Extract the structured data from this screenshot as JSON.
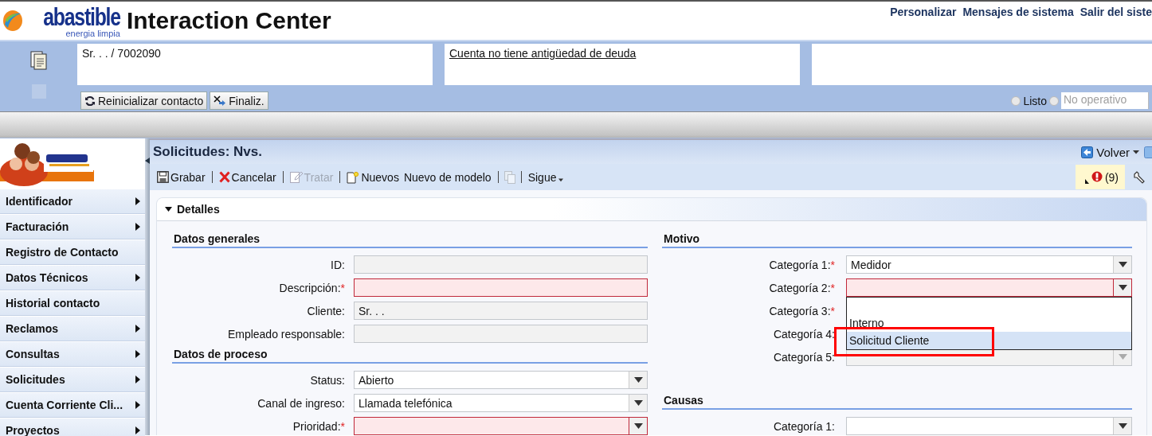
{
  "header": {
    "logo": {
      "name": "abastible",
      "tagline": "energia limpia"
    },
    "title": "Interaction Center",
    "links": [
      "Personalizar",
      "Mensajes de sistema",
      "Salir del siste"
    ]
  },
  "contact_bar": {
    "info_boxes": [
      {
        "kind": "plain",
        "text": "Sr. . . / 7002090"
      },
      {
        "kind": "link",
        "text": "Cuenta no tiene antigüedad de deuda "
      },
      {
        "kind": "empty"
      }
    ],
    "buttons": [
      "Reinicializar contacto",
      "Finaliz."
    ],
    "status_options": [
      {
        "label": "Listo",
        "selected": false,
        "kind": "radio"
      },
      {
        "label": "No operativo",
        "selected": false,
        "kind": "field"
      }
    ]
  },
  "sidebar": {
    "items": [
      {
        "label": "Identificador",
        "submenu": true
      },
      {
        "label": "Facturación",
        "submenu": true
      },
      {
        "label": "Registro de Contacto",
        "submenu": false
      },
      {
        "label": "Datos Técnicos",
        "submenu": true
      },
      {
        "label": "Historial contacto",
        "submenu": false
      },
      {
        "label": "Reclamos",
        "submenu": true
      },
      {
        "label": "Consultas",
        "submenu": true
      },
      {
        "label": "Solicitudes",
        "submenu": true
      },
      {
        "label": "Cuenta Corriente Cli...",
        "submenu": true
      },
      {
        "label": "Proyectos",
        "submenu": true
      }
    ]
  },
  "panel": {
    "title": "Solicitudes: Nvs.",
    "back": "Volver",
    "toolbar": [
      {
        "kind": "button",
        "label": "Grabar",
        "disabled": false
      },
      {
        "kind": "separator"
      },
      {
        "kind": "button",
        "label": "Cancelar",
        "disabled": false
      },
      {
        "kind": "separator"
      },
      {
        "kind": "button",
        "label": "Tratar",
        "disabled": true
      },
      {
        "kind": "separator"
      },
      {
        "kind": "button",
        "label": "Nuevos",
        "disabled": false
      },
      {
        "kind": "button",
        "label": "Nuevo de modelo",
        "disabled": false
      },
      {
        "kind": "separator"
      },
      {
        "kind": "icon",
        "disabled": true
      },
      {
        "kind": "separator"
      },
      {
        "kind": "menu",
        "label": "Sigue",
        "disabled": false
      }
    ],
    "messages": "(9)"
  },
  "details": {
    "title": "Detalles",
    "expanded": true,
    "columns": [
      {
        "sections": [
          {
            "title": "Datos generales",
            "fields": [
              {
                "label": "ID:",
                "kind": "text",
                "disabled": true,
                "error": false
              },
              {
                "label": "Descripción:",
                "required_mark": "*",
                "kind": "text",
                "disabled": false,
                "error": true
              },
              {
                "label": "Cliente:",
                "kind": "text",
                "value": "Sr. . .",
                "disabled": true,
                "error": false
              },
              {
                "label": "Empleado responsable:",
                "kind": "text",
                "disabled": true,
                "error": false
              }
            ]
          },
          {
            "title": "Datos de proceso",
            "fields": [
              {
                "label": "Status:",
                "kind": "select",
                "value": "Abierto",
                "disabled": false,
                "error": false
              },
              {
                "label": "Canal de ingreso:",
                "kind": "select",
                "value": "Llamada telefónica",
                "disabled": false,
                "error": false
              },
              {
                "label": "Prioridad:",
                "required_mark": "*",
                "kind": "select",
                "disabled": false,
                "error": true
              }
            ]
          }
        ]
      },
      {
        "sections": [
          {
            "title": "Motivo",
            "fields": [
              {
                "label": "Categoría 1:",
                "required_mark": "*",
                "kind": "select",
                "value": "Medidor",
                "disabled": false,
                "error": false
              },
              {
                "label": "Categoría 2:",
                "required_mark": "*",
                "kind": "select",
                "disabled": false,
                "error": true,
                "open": true,
                "options": [
                  {
                    "label": "Interno",
                    "selected": false,
                    "annotated": false
                  },
                  {
                    "label": "Solicitud Cliente",
                    "selected": true,
                    "annotated": true
                  }
                ]
              },
              {
                "label": "Categoría 3:",
                "required_mark": "*",
                "kind": "covered"
              },
              {
                "label": "Categoría 4:",
                "kind": "covered"
              },
              {
                "label": "Categoría 5:",
                "kind": "select",
                "disabled": true,
                "error": false
              }
            ]
          },
          {
            "title": "Causas",
            "fields": [
              {
                "label": "Categoría 1:",
                "kind": "select",
                "disabled": false,
                "error": false
              }
            ]
          }
        ]
      }
    ]
  }
}
